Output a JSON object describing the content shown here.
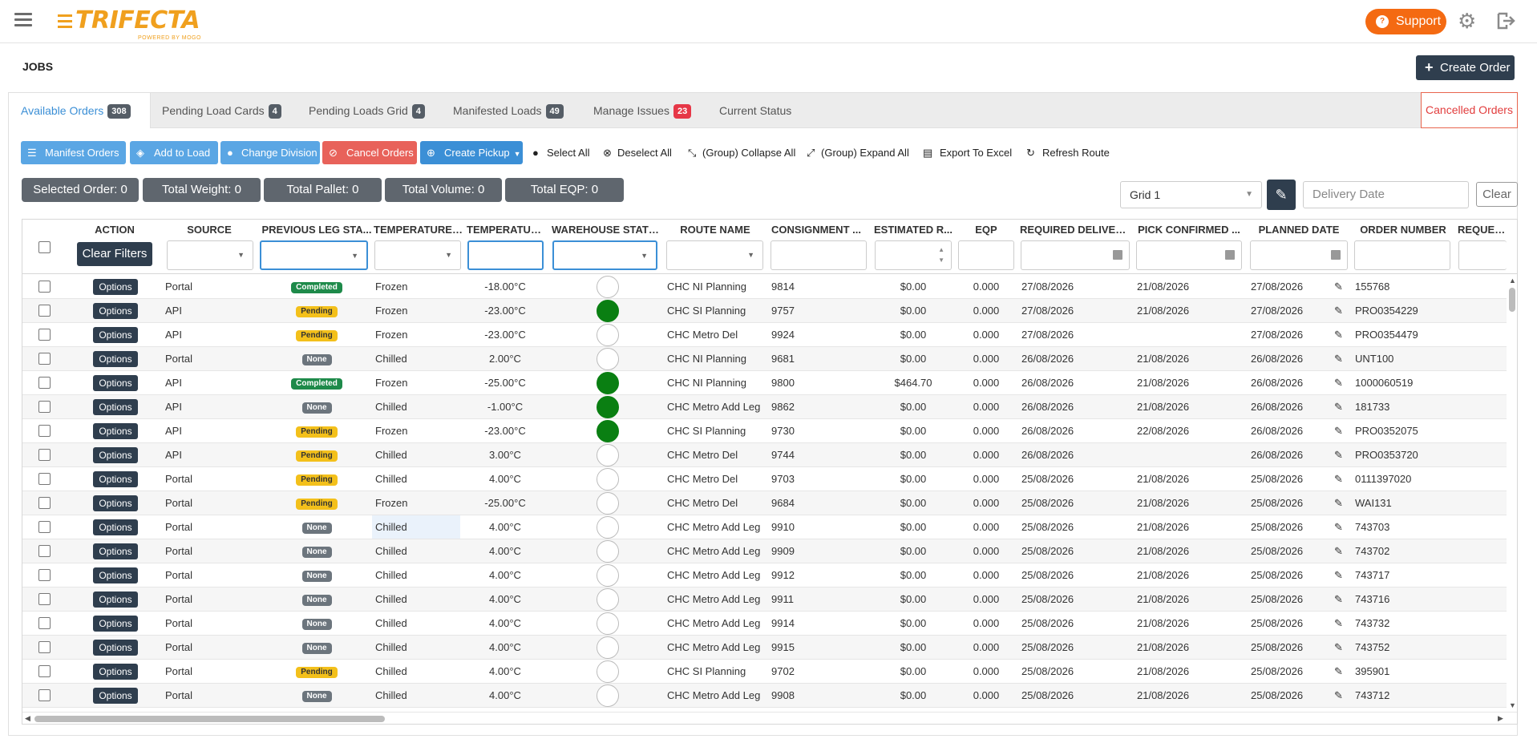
{
  "brand": {
    "name": "TRIFECTA",
    "tagline": "POWERED BY MOGO",
    "color": "#f0a01e"
  },
  "header": {
    "support_label": "Support"
  },
  "page": {
    "title": "JOBS",
    "create_order_label": "Create Order"
  },
  "tabs": [
    {
      "label": "Available Orders",
      "count": "308",
      "active": true
    },
    {
      "label": "Pending Load Cards",
      "count": "4"
    },
    {
      "label": "Pending Loads Grid",
      "count": "4"
    },
    {
      "label": "Manifested Loads",
      "count": "49"
    },
    {
      "label": "Manage Issues",
      "count": "23"
    },
    {
      "label": "Current Status",
      "count": ""
    }
  ],
  "cancelled_tab_label": "Cancelled Orders",
  "toolbar": {
    "manifest_orders": "Manifest Orders",
    "add_to_load": "Add to Load",
    "change_division": "Change Division",
    "cancel_orders": "Cancel Orders",
    "create_pickup": "Create Pickup",
    "select_all": "Select All",
    "deselect_all": "Deselect All",
    "collapse_all": "(Group) Collapse All",
    "expand_all": "(Group) Expand All",
    "export_excel": "Export To Excel",
    "refresh_route": "Refresh Route"
  },
  "stats": {
    "selected": "Selected Order: 0",
    "weight": "Total Weight: 0",
    "pallet": "Total Pallet: 0",
    "volume": "Total Volume: 0",
    "eqp": "Total EQP: 0"
  },
  "grid_controls": {
    "grid_select": "Grid 1",
    "date_placeholder": "Delivery Date",
    "clear_label": "Clear"
  },
  "columns": {
    "action": "ACTION",
    "source": "SOURCE",
    "prev_leg": "PREVIOUS LEG STA...",
    "temp_type": "TEMPERATURE ...",
    "temperature": "TEMPERATURE",
    "warehouse": "WAREHOUSE STATUS",
    "route": "ROUTE NAME",
    "consignment": "CONSIGNMENT ...",
    "estimated": "ESTIMATED R...",
    "eqp": "EQP",
    "required": "REQUIRED DELIVER...",
    "pick": "PICK CONFIRMED ...",
    "planned": "PLANNED DATE",
    "order": "ORDER NUMBER",
    "request": "REQUEST"
  },
  "clear_filters_label": "Clear Filters",
  "options_label": "Options",
  "rows": [
    {
      "source": "Portal",
      "prev": "Completed",
      "temp": "Frozen",
      "t": "-18.00°C",
      "wh": "off",
      "route": "CHC NI Planning",
      "cons": "9814",
      "est": "$0.00",
      "eqp": "0.000",
      "req": "27/08/2026",
      "pick": "21/08/2026",
      "plan": "27/08/2026",
      "order": "155768"
    },
    {
      "source": "API",
      "prev": "Pending",
      "temp": "Frozen",
      "t": "-23.00°C",
      "wh": "on",
      "route": "CHC SI Planning",
      "cons": "9757",
      "est": "$0.00",
      "eqp": "0.000",
      "req": "27/08/2026",
      "pick": "21/08/2026",
      "plan": "27/08/2026",
      "order": "PRO0354229"
    },
    {
      "source": "API",
      "prev": "Pending",
      "temp": "Frozen",
      "t": "-23.00°C",
      "wh": "off",
      "route": "CHC Metro Del",
      "cons": "9924",
      "est": "$0.00",
      "eqp": "0.000",
      "req": "27/08/2026",
      "pick": "",
      "plan": "27/08/2026",
      "order": "PRO0354479"
    },
    {
      "source": "Portal",
      "prev": "None",
      "temp": "Chilled",
      "t": "2.00°C",
      "wh": "off",
      "route": "CHC NI Planning",
      "cons": "9681",
      "est": "$0.00",
      "eqp": "0.000",
      "req": "26/08/2026",
      "pick": "21/08/2026",
      "plan": "26/08/2026",
      "order": "UNT100"
    },
    {
      "source": "API",
      "prev": "Completed",
      "temp": "Frozen",
      "t": "-25.00°C",
      "wh": "on",
      "route": "CHC NI Planning",
      "cons": "9800",
      "est": "$464.70",
      "eqp": "0.000",
      "req": "26/08/2026",
      "pick": "21/08/2026",
      "plan": "26/08/2026",
      "order": "1000060519"
    },
    {
      "source": "API",
      "prev": "None",
      "temp": "Chilled",
      "t": "-1.00°C",
      "wh": "on",
      "route": "CHC Metro Add Leg",
      "cons": "9862",
      "est": "$0.00",
      "eqp": "0.000",
      "req": "26/08/2026",
      "pick": "21/08/2026",
      "plan": "26/08/2026",
      "order": "181733"
    },
    {
      "source": "API",
      "prev": "Pending",
      "temp": "Frozen",
      "t": "-23.00°C",
      "wh": "on",
      "route": "CHC SI Planning",
      "cons": "9730",
      "est": "$0.00",
      "eqp": "0.000",
      "req": "26/08/2026",
      "pick": "22/08/2026",
      "plan": "26/08/2026",
      "order": "PRO0352075"
    },
    {
      "source": "API",
      "prev": "Pending",
      "temp": "Chilled",
      "t": "3.00°C",
      "wh": "off",
      "route": "CHC Metro Del",
      "cons": "9744",
      "est": "$0.00",
      "eqp": "0.000",
      "req": "26/08/2026",
      "pick": "",
      "plan": "26/08/2026",
      "order": "PRO0353720"
    },
    {
      "source": "Portal",
      "prev": "Pending",
      "temp": "Chilled",
      "t": "4.00°C",
      "wh": "off",
      "route": "CHC Metro Del",
      "cons": "9703",
      "est": "$0.00",
      "eqp": "0.000",
      "req": "25/08/2026",
      "pick": "21/08/2026",
      "plan": "25/08/2026",
      "order": "0111397020"
    },
    {
      "source": "Portal",
      "prev": "Pending",
      "temp": "Frozen",
      "t": "-25.00°C",
      "wh": "off",
      "route": "CHC Metro Del",
      "cons": "9684",
      "est": "$0.00",
      "eqp": "0.000",
      "req": "25/08/2026",
      "pick": "21/08/2026",
      "plan": "25/08/2026",
      "order": "WAI131"
    },
    {
      "source": "Portal",
      "prev": "None",
      "temp": "Chilled",
      "t": "4.00°C",
      "wh": "off",
      "route": "CHC Metro Add Leg",
      "cons": "9910",
      "est": "$0.00",
      "eqp": "0.000",
      "req": "25/08/2026",
      "pick": "21/08/2026",
      "plan": "25/08/2026",
      "order": "743703"
    },
    {
      "source": "Portal",
      "prev": "None",
      "temp": "Chilled",
      "t": "4.00°C",
      "wh": "off",
      "route": "CHC Metro Add Leg",
      "cons": "9909",
      "est": "$0.00",
      "eqp": "0.000",
      "req": "25/08/2026",
      "pick": "21/08/2026",
      "plan": "25/08/2026",
      "order": "743702"
    },
    {
      "source": "Portal",
      "prev": "None",
      "temp": "Chilled",
      "t": "4.00°C",
      "wh": "off",
      "route": "CHC Metro Add Leg",
      "cons": "9912",
      "est": "$0.00",
      "eqp": "0.000",
      "req": "25/08/2026",
      "pick": "21/08/2026",
      "plan": "25/08/2026",
      "order": "743717"
    },
    {
      "source": "Portal",
      "prev": "None",
      "temp": "Chilled",
      "t": "4.00°C",
      "wh": "off",
      "route": "CHC Metro Add Leg",
      "cons": "9911",
      "est": "$0.00",
      "eqp": "0.000",
      "req": "25/08/2026",
      "pick": "21/08/2026",
      "plan": "25/08/2026",
      "order": "743716"
    },
    {
      "source": "Portal",
      "prev": "None",
      "temp": "Chilled",
      "t": "4.00°C",
      "wh": "off",
      "route": "CHC Metro Add Leg",
      "cons": "9914",
      "est": "$0.00",
      "eqp": "0.000",
      "req": "25/08/2026",
      "pick": "21/08/2026",
      "plan": "25/08/2026",
      "order": "743732"
    },
    {
      "source": "Portal",
      "prev": "None",
      "temp": "Chilled",
      "t": "4.00°C",
      "wh": "off",
      "route": "CHC Metro Add Leg",
      "cons": "9915",
      "est": "$0.00",
      "eqp": "0.000",
      "req": "25/08/2026",
      "pick": "21/08/2026",
      "plan": "25/08/2026",
      "order": "743752"
    },
    {
      "source": "Portal",
      "prev": "Pending",
      "temp": "Chilled",
      "t": "4.00°C",
      "wh": "off",
      "route": "CHC SI Planning",
      "cons": "9702",
      "est": "$0.00",
      "eqp": "0.000",
      "req": "25/08/2026",
      "pick": "21/08/2026",
      "plan": "25/08/2026",
      "order": "395901"
    },
    {
      "source": "Portal",
      "prev": "None",
      "temp": "Chilled",
      "t": "4.00°C",
      "wh": "off",
      "route": "CHC Metro Add Leg",
      "cons": "9908",
      "est": "$0.00",
      "eqp": "0.000",
      "req": "25/08/2026",
      "pick": "21/08/2026",
      "plan": "25/08/2026",
      "order": "743712"
    }
  ]
}
